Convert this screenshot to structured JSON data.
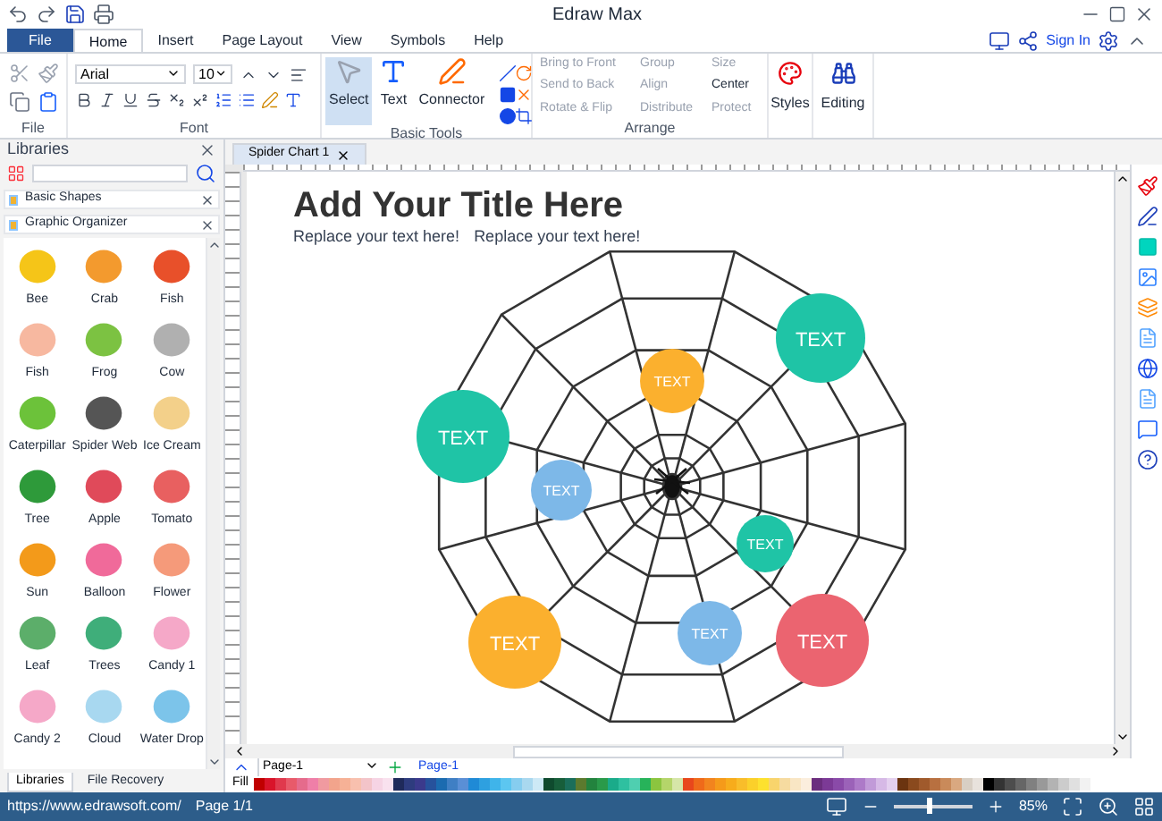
{
  "window": {
    "title": "Edraw Max"
  },
  "menu_tabs": [
    {
      "label": "File",
      "kind": "file",
      "selected": false
    },
    {
      "label": "Home",
      "kind": "tab",
      "selected": true
    },
    {
      "label": "Insert",
      "kind": "tab",
      "selected": false
    },
    {
      "label": "Page Layout",
      "kind": "tab",
      "selected": false
    },
    {
      "label": "View",
      "kind": "tab",
      "selected": false
    },
    {
      "label": "Symbols",
      "kind": "tab",
      "selected": false
    },
    {
      "label": "Help",
      "kind": "tab",
      "selected": false
    }
  ],
  "account": {
    "sign_in": "Sign In"
  },
  "ribbon": {
    "file_group": "File",
    "font_group": "Font",
    "font_name": "Arial",
    "font_size": "10",
    "basic_tools_group": "Basic Tools",
    "tools": [
      {
        "label": "Select",
        "selected": true
      },
      {
        "label": "Text",
        "selected": false
      },
      {
        "label": "Connector",
        "selected": false
      }
    ],
    "arrange_group": "Arrange",
    "arrange": [
      {
        "label": "Bring to Front",
        "disabled": true
      },
      {
        "label": "Group",
        "disabled": true
      },
      {
        "label": "Size",
        "disabled": true
      },
      {
        "label": "Send to Back",
        "disabled": true
      },
      {
        "label": "Align",
        "disabled": true
      },
      {
        "label": "Center",
        "disabled": false
      },
      {
        "label": "Rotate & Flip",
        "disabled": true
      },
      {
        "label": "Distribute",
        "disabled": true
      },
      {
        "label": "Protect",
        "disabled": true
      }
    ],
    "styles": "Styles",
    "editing": "Editing"
  },
  "libraries": {
    "title": "Libraries",
    "sections": [
      "Basic Shapes",
      "Graphic Organizer"
    ],
    "items": [
      {
        "label": "Bee",
        "color": "#f5c518"
      },
      {
        "label": "Crab",
        "color": "#f39a2e"
      },
      {
        "label": "Fish",
        "color": "#e8502a"
      },
      {
        "label": "Fish",
        "color": "#f7b8a0"
      },
      {
        "label": "Frog",
        "color": "#7cc242"
      },
      {
        "label": "Cow",
        "color": "#b0b0b0"
      },
      {
        "label": "Caterpillar",
        "color": "#6cc23a"
      },
      {
        "label": "Spider Web",
        "color": "#555555"
      },
      {
        "label": "Ice Cream",
        "color": "#f3d08a"
      },
      {
        "label": "Tree",
        "color": "#2e9a3a"
      },
      {
        "label": "Apple",
        "color": "#e04a5a"
      },
      {
        "label": "Tomato",
        "color": "#e86060"
      },
      {
        "label": "Sun",
        "color": "#f39a1a"
      },
      {
        "label": "Balloon",
        "color": "#f06a9a"
      },
      {
        "label": "Flower",
        "color": "#f59a7a"
      },
      {
        "label": "Leaf",
        "color": "#5cae6a"
      },
      {
        "label": "Trees",
        "color": "#3fae7a"
      },
      {
        "label": "Candy 1",
        "color": "#f5a8c8"
      },
      {
        "label": "Candy 2",
        "color": "#f5a8c8"
      },
      {
        "label": "Cloud",
        "color": "#a8d8f0"
      },
      {
        "label": "Water Drop",
        "color": "#7cc4ea"
      }
    ],
    "bottom_tabs": [
      {
        "label": "Libraries",
        "selected": true
      },
      {
        "label": "File Recovery",
        "selected": false
      }
    ]
  },
  "document_tab": "Spider Chart 1",
  "canvas": {
    "title": "Add Your Title Here",
    "subtitles": [
      "Replace your text here!",
      "Replace your text here!"
    ],
    "bubbles": [
      {
        "label": "TEXT",
        "color": "#1fc4a6"
      },
      {
        "label": "TEXT",
        "color": "#1fc4a6"
      },
      {
        "label": "TEXT",
        "color": "#fbb02e"
      },
      {
        "label": "TEXT",
        "color": "#7db8e8"
      },
      {
        "label": "TEXT",
        "color": "#1fc4a6"
      },
      {
        "label": "TEXT",
        "color": "#fbb02e"
      },
      {
        "label": "TEXT",
        "color": "#7db8e8"
      },
      {
        "label": "TEXT",
        "color": "#eb6470"
      }
    ]
  },
  "pages": {
    "selector": "Page-1",
    "tabs": [
      {
        "label": "Page-1",
        "selected": true
      }
    ]
  },
  "fill": {
    "label": "Fill",
    "swatches": [
      {
        "color": "#c00000"
      },
      {
        "color": "#d9142a"
      },
      {
        "color": "#e0394d"
      },
      {
        "color": "#e85a6a"
      },
      {
        "color": "#e56b8c"
      },
      {
        "color": "#ef7fa8"
      },
      {
        "color": "#f09aa0"
      },
      {
        "color": "#f2a48c"
      },
      {
        "color": "#f6b196"
      },
      {
        "color": "#f8c0ae"
      },
      {
        "color": "#f3c4c9"
      },
      {
        "color": "#f6d4e4"
      },
      {
        "color": "#f9e1ee"
      },
      {
        "color": "#1f2a5a"
      },
      {
        "color": "#2e3c7e"
      },
      {
        "color": "#3b3a8c"
      },
      {
        "color": "#27529c"
      },
      {
        "color": "#1b6bb0"
      },
      {
        "color": "#3f7fc4"
      },
      {
        "color": "#5a8fd6"
      },
      {
        "color": "#1f8ad6"
      },
      {
        "color": "#2ea0e0"
      },
      {
        "color": "#3fb4ea"
      },
      {
        "color": "#5cc6f0"
      },
      {
        "color": "#86cdef"
      },
      {
        "color": "#a9d8ef"
      },
      {
        "color": "#cde9f6"
      },
      {
        "color": "#0f4a2e"
      },
      {
        "color": "#175e3a"
      },
      {
        "color": "#1a6e5a"
      },
      {
        "color": "#5c7a2e"
      },
      {
        "color": "#23833e"
      },
      {
        "color": "#2a9a4a"
      },
      {
        "color": "#1aab8a"
      },
      {
        "color": "#2fc0a0"
      },
      {
        "color": "#4fcfb0"
      },
      {
        "color": "#27b35a"
      },
      {
        "color": "#8bc53f"
      },
      {
        "color": "#b5d56a"
      },
      {
        "color": "#d6e6a8"
      },
      {
        "color": "#e8471c"
      },
      {
        "color": "#ef6a1a"
      },
      {
        "color": "#f2841e"
      },
      {
        "color": "#f59a1a"
      },
      {
        "color": "#f7ac1c"
      },
      {
        "color": "#f9bd2a"
      },
      {
        "color": "#fbd02a"
      },
      {
        "color": "#fde12e"
      },
      {
        "color": "#f8d46c"
      },
      {
        "color": "#f6dba0"
      },
      {
        "color": "#f9e6c4"
      },
      {
        "color": "#fbeedd"
      },
      {
        "color": "#6b2e7e"
      },
      {
        "color": "#7c3a96"
      },
      {
        "color": "#8a4aa8"
      },
      {
        "color": "#9b62b8"
      },
      {
        "color": "#ad7ac8"
      },
      {
        "color": "#c19ad8"
      },
      {
        "color": "#d6b9e6"
      },
      {
        "color": "#e4d0ef"
      },
      {
        "color": "#6b3410"
      },
      {
        "color": "#8a4a1e"
      },
      {
        "color": "#a05a2c"
      },
      {
        "color": "#b87040"
      },
      {
        "color": "#c98a5a"
      },
      {
        "color": "#d9a880"
      },
      {
        "color": "#d8cfc4"
      },
      {
        "color": "#e8e2dc"
      },
      {
        "color": "#000000"
      },
      {
        "color": "#333333"
      },
      {
        "color": "#4d4d4d"
      },
      {
        "color": "#666666"
      },
      {
        "color": "#808080"
      },
      {
        "color": "#999999"
      },
      {
        "color": "#b3b3b3"
      },
      {
        "color": "#cccccc"
      },
      {
        "color": "#e0e0e0"
      },
      {
        "color": "#f2f2f2"
      }
    ]
  },
  "status_bar": {
    "url": "https://www.edrawsoft.com/",
    "page": "Page 1/1",
    "zoom": "85%",
    "zoom_slider": {
      "level": 0.45
    }
  }
}
